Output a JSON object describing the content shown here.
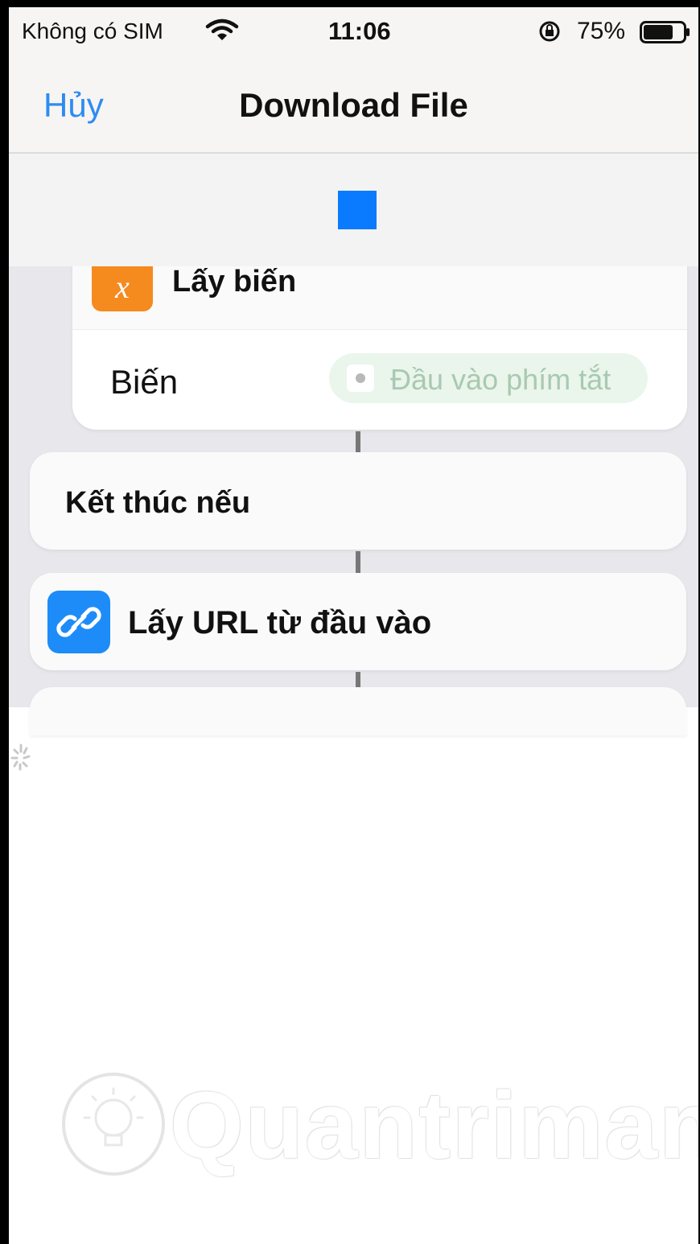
{
  "status_bar": {
    "carrier": "Không có SIM",
    "time": "11:06",
    "battery_percent": "75%",
    "battery_level": 0.75
  },
  "nav": {
    "cancel": "Hủy",
    "title": "Download File"
  },
  "actions": {
    "get_variable": {
      "title": "Lấy biến",
      "param_label": "Biến",
      "param_value": "Đầu vào phím tắt",
      "icon_glyph": "x",
      "icon_color": "#f58a1f"
    },
    "end_if": {
      "title": "Kết thúc nếu"
    },
    "get_urls": {
      "title": "Lấy URL từ đầu vào",
      "icon_color": "#1d8cf8"
    }
  },
  "accent_color": "#0a7bff",
  "watermark": "Quantrimang"
}
